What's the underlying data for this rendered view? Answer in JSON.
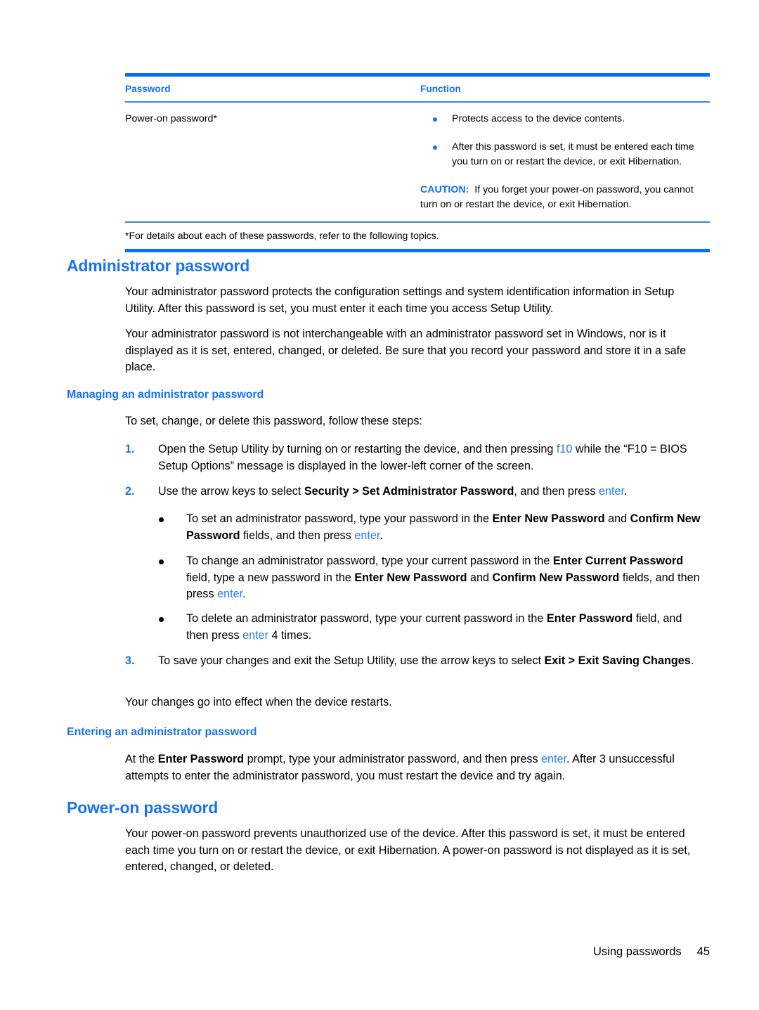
{
  "table": {
    "headers": {
      "password": "Password",
      "function": "Function"
    },
    "row": {
      "password": "Power-on password*",
      "bullets": [
        "Protects access to the device contents.",
        "After this password is set, it must be entered each time you turn on or restart the device, or exit Hibernation."
      ],
      "caution_label": "CAUTION:",
      "caution_text": "If you forget your power-on password, you cannot turn on or restart the device, or exit Hibernation."
    },
    "footnote": "*For details about each of these passwords, refer to the following topics."
  },
  "admin_section": {
    "heading": "Administrator password",
    "paragraph1": "Your administrator password protects the configuration settings and system identification information in Setup Utility. After this password is set, you must enter it each time you access Setup Utility.",
    "paragraph2": "Your administrator password is not interchangeable with an administrator password set in Windows, nor is it displayed as it is set, entered, changed, or deleted. Be sure that you record your password and store it in a safe place."
  },
  "managing_section": {
    "heading": "Managing an administrator password",
    "intro": "To set, change, or delete this password, follow these steps:",
    "step1": {
      "number": "1.",
      "part1": "Open the Setup Utility by turning on or restarting the device, and then pressing ",
      "key1": "f10",
      "part2": " while the “F10 = BIOS Setup Options” message is displayed in the lower-left corner of the screen."
    },
    "step2": {
      "number": "2.",
      "part1": "Use the arrow keys to select ",
      "bold1": "Security > Set Administrator Password",
      "part2": ", and then press ",
      "key1": "enter",
      "part3": "."
    },
    "bullets": [
      {
        "part1": "To set an administrator password, type your password in the ",
        "bold1": "Enter New Password",
        "part2": " and ",
        "bold2": "Confirm New Password",
        "part3": " fields, and then press ",
        "key1": "enter",
        "part4": "."
      },
      {
        "part1": "To change an administrator password, type your current password in the ",
        "bold1": "Enter Current Password",
        "part2": " field, type a new password in the ",
        "bold2": "Enter New Password",
        "part3": " and ",
        "bold3": "Confirm New Password",
        "part4": " fields, and then press ",
        "key1": "enter",
        "part5": "."
      },
      {
        "part1": "To delete an administrator password, type your current password in the ",
        "bold1": "Enter Password",
        "part2": " field, and then press ",
        "key1": "enter",
        "part3": " 4 times."
      }
    ],
    "step3": {
      "number": "3.",
      "part1": "To save your changes and exit the Setup Utility, use the arrow keys to select ",
      "bold1": "Exit > Exit Saving Changes",
      "part2": "."
    },
    "closing": "Your changes go into effect when the device restarts."
  },
  "entering_section": {
    "heading": "Entering an administrator password",
    "part1": "At the ",
    "bold1": "Enter Password",
    "part2": " prompt, type your administrator password, and then press ",
    "key1": "enter",
    "part3": ". After 3 unsuccessful attempts to enter the administrator password, you must restart the device and try again."
  },
  "poweron_section": {
    "heading": "Power-on password",
    "paragraph1": "Your power-on password prevents unauthorized use of the device. After this password is set, it must be entered each time you turn on or restart the device, or exit Hibernation. A power-on password is not displayed as it is set, entered, changed, or deleted."
  },
  "footer": {
    "title": "Using passwords",
    "page_number": "45"
  },
  "colors": {
    "heading_blue": "#1a73f0",
    "rule_blue": "#0b6ef5",
    "rule_thin_blue": "#3a87de",
    "key_blue": "#2a7bf0",
    "text_black": "#000000"
  }
}
